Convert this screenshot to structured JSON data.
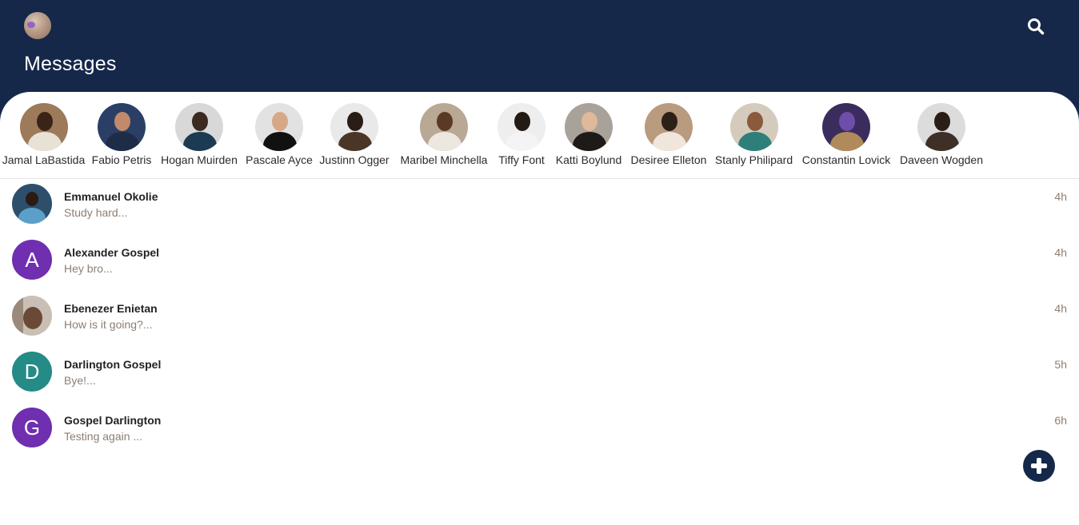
{
  "header": {
    "title": "Messages",
    "background": "#15284a",
    "profile_icon": "user-avatar",
    "search_icon": "search-icon"
  },
  "stories": [
    {
      "name": "Jamal LaBastida"
    },
    {
      "name": "Fabio Petris"
    },
    {
      "name": "Hogan Muirden"
    },
    {
      "name": "Pascale Ayce"
    },
    {
      "name": "Justinn Ogger"
    },
    {
      "name": "Maribel Minchella"
    },
    {
      "name": "Tiffy Font"
    },
    {
      "name": "Katti Boylund"
    },
    {
      "name": "Desiree Elleton"
    },
    {
      "name": "Stanly Philipard"
    },
    {
      "name": "Constantin Lovick"
    },
    {
      "name": "Daveen Wogden"
    }
  ],
  "conversations": [
    {
      "name": "Emmanuel Okolie",
      "preview": "Study hard...",
      "time": "4h",
      "initial": "",
      "avatar_color": ""
    },
    {
      "name": "Alexander Gospel",
      "preview": "Hey bro...",
      "time": "4h",
      "initial": "A",
      "avatar_color": "#6f2fb0"
    },
    {
      "name": "Ebenezer Enietan",
      "preview": "How is it going?...",
      "time": "4h",
      "initial": "",
      "avatar_color": ""
    },
    {
      "name": "Darlington Gospel",
      "preview": "Bye!...",
      "time": "5h",
      "initial": "D",
      "avatar_color": "#258b86"
    },
    {
      "name": "Gospel Darlington",
      "preview": "Testing again ...",
      "time": "6h",
      "initial": "G",
      "avatar_color": "#6f2fb0"
    }
  ],
  "fab": {
    "icon": "plus-icon"
  }
}
